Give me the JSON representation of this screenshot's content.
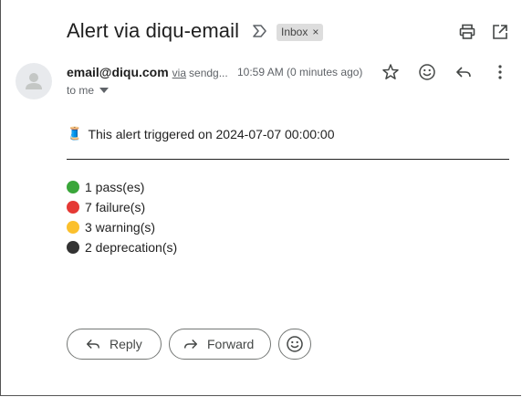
{
  "email": {
    "subject": "Alert via diqu-email",
    "label": "Inbox",
    "sender": "email@diqu.com",
    "via_text": "via",
    "via_host": "sendg...",
    "time": "10:59 AM (0 minutes ago)",
    "recipient": "to me",
    "alert_emoji": "🧵",
    "alert_line": "This alert triggered on 2024-07-07 00:00:00",
    "summary": [
      {
        "label": "1 pass(es)",
        "color": "#3aa63a"
      },
      {
        "label": "7 failure(s)",
        "color": "#e53935"
      },
      {
        "label": "3 warning(s)",
        "color": "#fbc02d"
      },
      {
        "label": "2 deprecation(s)",
        "color": "#333333"
      }
    ]
  },
  "actions": {
    "reply": "Reply",
    "forward": "Forward"
  }
}
